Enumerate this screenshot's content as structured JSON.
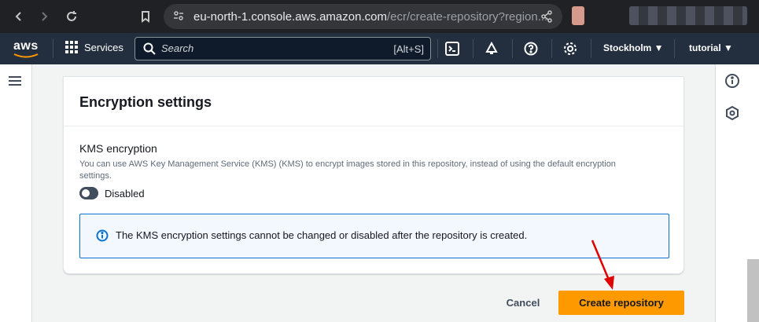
{
  "browser": {
    "url_host": "eu-north-1.console.aws.amazon.com",
    "url_path": "/ecr/create-repository?region..."
  },
  "aws_nav": {
    "logo": "aws",
    "services_label": "Services",
    "search_placeholder": "Search",
    "search_shortcut": "[Alt+S]",
    "region_label": "Stockholm ▼",
    "account_label": "tutorial ▼"
  },
  "encryption_panel": {
    "title": "Encryption settings",
    "kms_label": "KMS encryption",
    "kms_description": "You can use AWS Key Management Service (KMS) (KMS) to encrypt images stored in this repository, instead of using the default encryption settings.",
    "toggle_label": "Disabled",
    "toggle_enabled": false,
    "info_message": "The KMS encryption settings cannot be changed or disabled after the repository is created."
  },
  "actions": {
    "cancel_label": "Cancel",
    "create_label": "Create repository"
  },
  "colors": {
    "aws_nav_bg": "#232f3e",
    "primary_button": "#ff9900",
    "info_border": "#0972d3",
    "annotation_arrow": "#e00000"
  }
}
